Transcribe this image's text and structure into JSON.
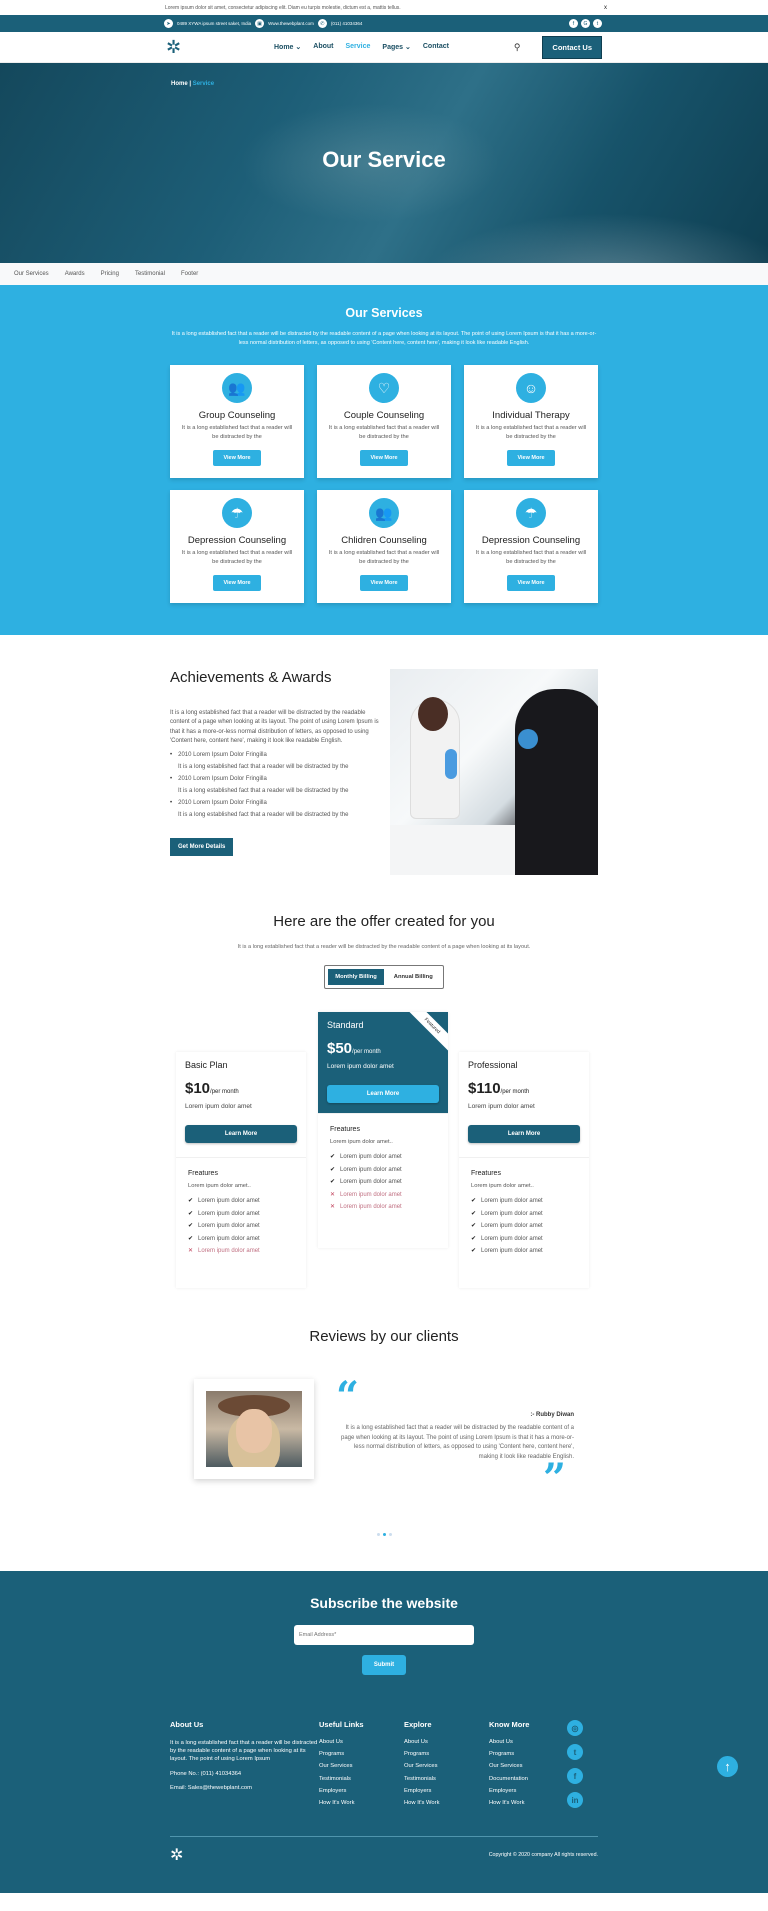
{
  "notice": {
    "text": "Lorem ipsum dolor sit amet, consectetur adipiscing elit. Diam eu turpis molestie, dictum est a, mattis tellus.",
    "close": "x"
  },
  "info": {
    "address": "0489 XYWA ipsum street saket, India",
    "website": "Www.thewebplant.com",
    "phone": "(011) 41034364",
    "address_icon": "location-arrow-icon",
    "web_icon": "globe-icon",
    "phone_icon": "phone-icon",
    "social": [
      "f",
      "G",
      "t"
    ]
  },
  "nav": {
    "items": [
      {
        "label": "Home",
        "caret": "⌄"
      },
      {
        "label": "About",
        "caret": ""
      },
      {
        "label": "Service",
        "caret": ""
      },
      {
        "label": "Pages",
        "caret": "⌄"
      },
      {
        "label": "Contact",
        "caret": ""
      }
    ],
    "active": "Service",
    "search_icon": "⚲",
    "contact_label": "Contact Us"
  },
  "hero": {
    "crumb_home": "Home",
    "crumb_sep": "|",
    "crumb_current": "Service",
    "title": "Our Service"
  },
  "subnav": [
    "Our Services",
    "Awards",
    "Pricing",
    "Testimonial",
    "Footer"
  ],
  "services": {
    "title": "Our Services",
    "lead": "It is a long established fact that a reader will be distracted by the readable content of a page when looking at its layout. The point of using Lorem Ipsum is that it has a more-or-less normal distribution of letters, as opposed to using 'Content here, content here', making it look like readable English.",
    "cards": [
      {
        "title": "Group Counseling",
        "text": "It is a long established fact that a reader will be distracted by the",
        "button": "View More",
        "icon": "👥"
      },
      {
        "title": "Couple Counseling",
        "text": "It is a long established fact that a reader will be distracted by the",
        "button": "View More",
        "icon": "♡"
      },
      {
        "title": "Individual Therapy",
        "text": "It is a long established fact that a reader will be distracted by the",
        "button": "View More",
        "icon": "☺"
      },
      {
        "title": "Depression Counseling",
        "text": "It is a long established fact that a reader will be distracted by the",
        "button": "View More",
        "icon": "☂"
      },
      {
        "title": "Chlidren Counseling",
        "text": "It is a long established fact that a reader will be distracted by the",
        "button": "View More",
        "icon": "👥"
      },
      {
        "title": "Depression Counseling",
        "text": "It is a long established fact that a reader will be distracted by the",
        "button": "View More",
        "icon": "☂"
      }
    ]
  },
  "awards": {
    "title": "Achievements & Awards",
    "lead": "It is a long established fact that a reader will be distracted by the readable content of a page when looking at its layout. The point of using Lorem Ipsum is that it has a more-or-less normal distribution of letters, as opposed to using 'Content here, content here', making it look like readable English.",
    "items": [
      {
        "title": "2010 Lorem Ipsum Dolor Fringilla",
        "text": "It is a long established fact that a reader will be distracted by the"
      },
      {
        "title": "2010 Lorem Ipsum Dolor Fringilla",
        "text": "It is a long established fact that a reader will be distracted by the"
      },
      {
        "title": "2010 Lorem Ipsum Dolor Fringilla",
        "text": "It is a long established fact that a reader will be distracted by the"
      }
    ],
    "button": "Get More Details"
  },
  "pricing": {
    "title": "Here are the offer created for you",
    "lead": "It is a long established fact that a reader will be distracted by the readable content of a page when looking at its layout.",
    "toggle": {
      "monthly": "Monthly Billing",
      "annual": "Annual Billing",
      "selected": "Monthly Billing"
    },
    "plans": [
      {
        "name": "Basic Plan",
        "price": "$10",
        "period": "/per month",
        "desc": "Lorem ipum dolor amet",
        "button": "Learn More",
        "features_title": "Freatures",
        "features_lead": "Lorem ipum dolor amet..",
        "features": [
          {
            "text": "Lorem ipum dolor amet",
            "included": true
          },
          {
            "text": "Lorem ipum dolor amet",
            "included": true
          },
          {
            "text": "Lorem ipum dolor amet",
            "included": true
          },
          {
            "text": "Lorem ipum dolor amet",
            "included": true
          },
          {
            "text": "Lorem ipum dolor amet",
            "included": false
          }
        ]
      },
      {
        "name": "Standard",
        "price": "$50",
        "period": "/per month",
        "desc": "Lorem ipum dolor amet",
        "button": "Learn More",
        "badge": "Featured",
        "features_title": "Freatures",
        "features_lead": "Lorem ipum dolor amet..",
        "features": [
          {
            "text": "Lorem ipum dolor amet",
            "included": true
          },
          {
            "text": "Lorem ipum dolor amet",
            "included": true
          },
          {
            "text": "Lorem ipum dolor amet",
            "included": true
          },
          {
            "text": "Lorem ipum dolor amet",
            "included": false
          },
          {
            "text": "Lorem ipum dolor amet",
            "included": false
          }
        ]
      },
      {
        "name": "Professional",
        "price": "$110",
        "period": "/per month",
        "desc": "Lorem ipum dolor amet",
        "button": "Learn More",
        "features_title": "Freatures",
        "features_lead": "Lorem ipum dolor amet..",
        "features": [
          {
            "text": "Lorem ipum dolor amet",
            "included": true
          },
          {
            "text": "Lorem ipum dolor amet",
            "included": true
          },
          {
            "text": "Lorem ipum dolor amet",
            "included": true
          },
          {
            "text": "Lorem ipum dolor amet",
            "included": true
          },
          {
            "text": "Lorem ipum dolor amet",
            "included": true
          }
        ]
      }
    ]
  },
  "reviews": {
    "title": "Reviews by our clients",
    "open_quote": "“",
    "close_quote": "”",
    "name": ":- Rubby Diwan",
    "quote": "It is a long established fact that a reader will be distracted by the readable content of a page when looking at its layout. The point of using Lorem Ipsum is that it has a more-or-less normal distribution of letters, as opposed to using 'Content here, content here', making it look like readable English.",
    "slides": 3,
    "active_slide": 2
  },
  "footer": {
    "subscribe_title": "Subscribe the website",
    "email_placeholder": "Email Address*",
    "submit": "Submit",
    "about": {
      "title": "About Us",
      "text": "It is a long established fact that a reader will be distracted by the readable content of a page when looking at its layout. The point of using Lorem Ipsum",
      "phone": "Phone No.: (011) 41034364",
      "email": "Email: Sales@thewebplant.com"
    },
    "useful": {
      "title": "Useful Links",
      "links": [
        "About Us",
        "Programs",
        "Our Services",
        "Testimonials",
        "Employers",
        "How It's Work"
      ]
    },
    "explore": {
      "title": "Explore",
      "links": [
        "About Us",
        "Programs",
        "Our Services",
        "Testimonials",
        "Employers",
        "How It's Work"
      ]
    },
    "know": {
      "title": "Know More",
      "links": [
        "About Us",
        "Programs",
        "Our Services",
        "Documentation",
        "Employers",
        "How It's Work"
      ]
    },
    "social": [
      "◎",
      "t",
      "f",
      "in"
    ],
    "to_top": "↑",
    "copyright": "Copyright © 2020 company All rights reserved."
  },
  "colors": {
    "primary": "#1b6079",
    "accent": "#2eb0e1",
    "negative": "#c0405a"
  }
}
